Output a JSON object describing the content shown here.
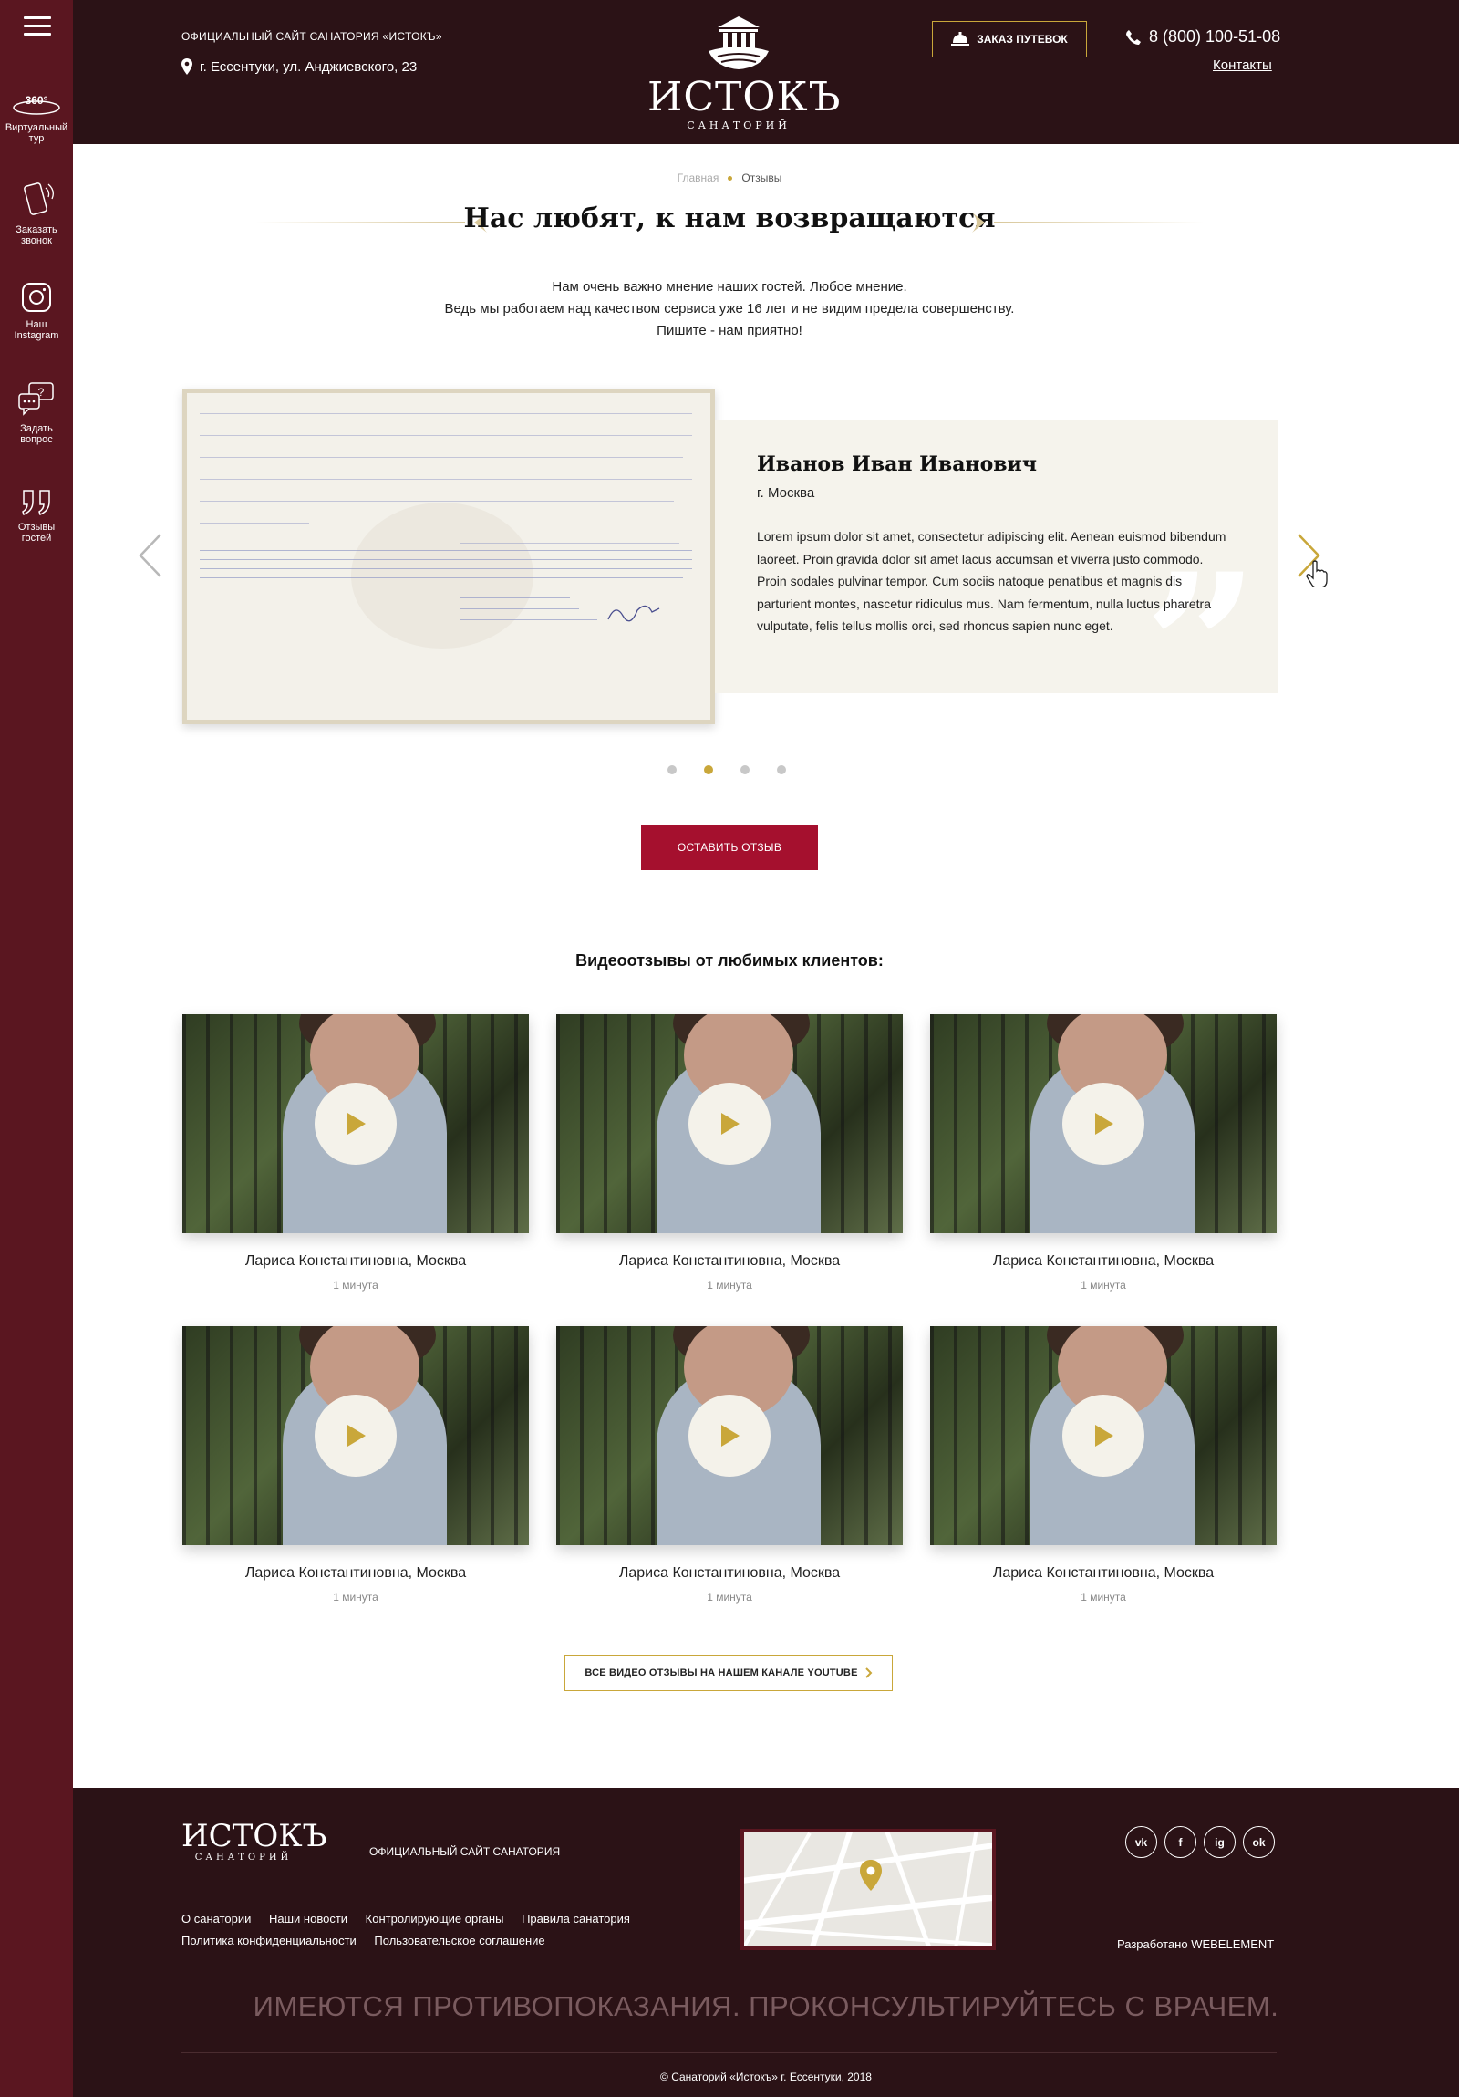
{
  "sidebar": {
    "items": [
      {
        "label": "Виртуальный тур",
        "icon": "360-icon"
      },
      {
        "label": "Заказать звонок",
        "icon": "phone-call-icon"
      },
      {
        "label": "Наш Instagram",
        "icon": "instagram-icon"
      },
      {
        "label": "Задать вопрос",
        "icon": "question-chat-icon"
      },
      {
        "label": "Отзывы гостей",
        "icon": "quote-icon"
      }
    ],
    "badge_360": "360°"
  },
  "header": {
    "official": "ОФИЦИАЛЬНЫЙ САЙТ САНАТОРИЯ «ИСТОКЪ»",
    "address": "г. Ессентуки, ул. Анджиевского, 23",
    "logo_name": "ИСТОКЪ",
    "logo_sub": "САНАТОРИЙ",
    "order_label": "ЗАКАЗ ПУТЕВОК",
    "phone": "8 (800) 100-51-08",
    "contacts": "Контакты"
  },
  "breadcrumb": {
    "home": "Главная",
    "current": "Отзывы"
  },
  "page": {
    "title": "Нас любят, к нам возвращаются",
    "intro_lines": [
      "Нам очень важно мнение наших гостей. Любое мнение.",
      "Ведь мы работаем над качеством сервиса уже 16 лет и не видим предела совершенству.",
      "Пишите - нам приятно!"
    ]
  },
  "review": {
    "name": "Иванов Иван Иванович",
    "city": "г. Москва",
    "text": "Lorem ipsum dolor sit amet, consectetur adipiscing elit. Aenean euismod bibendum laoreet. Proin gravida dolor sit amet lacus accumsan et viverra justo commodo. Proin sodales pulvinar tempor. Cum sociis natoque penatibus et magnis dis parturient montes, nascetur ridiculus mus. Nam fermentum, nulla luctus pharetra vulputate, felis tellus mollis orci, sed rhoncus sapien nunc eget.",
    "slides_total": 4,
    "active_slide": 2
  },
  "leave_review": "ОСТАВИТЬ ОТЗЫВ",
  "videos_title": "Видеоотзывы от любимых клиентов:",
  "videos": [
    {
      "name": "Лариса Константиновна, Москва",
      "duration": "1 минута"
    },
    {
      "name": "Лариса Константиновна, Москва",
      "duration": "1 минута"
    },
    {
      "name": "Лариса Константиновна, Москва",
      "duration": "1 минута"
    },
    {
      "name": "Лариса Константиновна, Москва",
      "duration": "1 минута"
    },
    {
      "name": "Лариса Константиновна, Москва",
      "duration": "1 минута"
    },
    {
      "name": "Лариса Константиновна, Москва",
      "duration": "1 минута"
    }
  ],
  "youtube_button": "ВСЕ ВИДЕО ОТЗЫВЫ НА НАШЕМ КАНАЛЕ YOUTUBE",
  "footer": {
    "logo_name": "ИСТОКЪ",
    "logo_sub": "САНАТОРИЙ",
    "official": "ОФИЦИАЛЬНЫЙ САЙТ САНАТОРИЯ",
    "links_row1": [
      "О санатории",
      "Наши новости",
      "Контролирующие органы",
      "Правила санатория"
    ],
    "links_row2": [
      "Политика конфиденциальности",
      "Пользовательское соглашение"
    ],
    "social": [
      {
        "label": "vk",
        "icon": "vk-icon"
      },
      {
        "label": "f",
        "icon": "facebook-icon"
      },
      {
        "label": "ig",
        "icon": "instagram-icon"
      },
      {
        "label": "ok",
        "icon": "odnoklassniki-icon"
      }
    ],
    "developer": "Разработано WEBELEMENT",
    "warning": "ИМЕЮТСЯ ПРОТИВОПОКАЗАНИЯ. ПРОКОНСУЛЬТИРУЙТЕСЬ С ВРАЧЕМ.",
    "copyright": "© Санаторий «Истокъ» г. Ессентуки, 2018"
  },
  "colors": {
    "sidebar": "#5a1620",
    "header": "#2b1216",
    "accent": "#c9a73a",
    "button": "#a5102e"
  }
}
